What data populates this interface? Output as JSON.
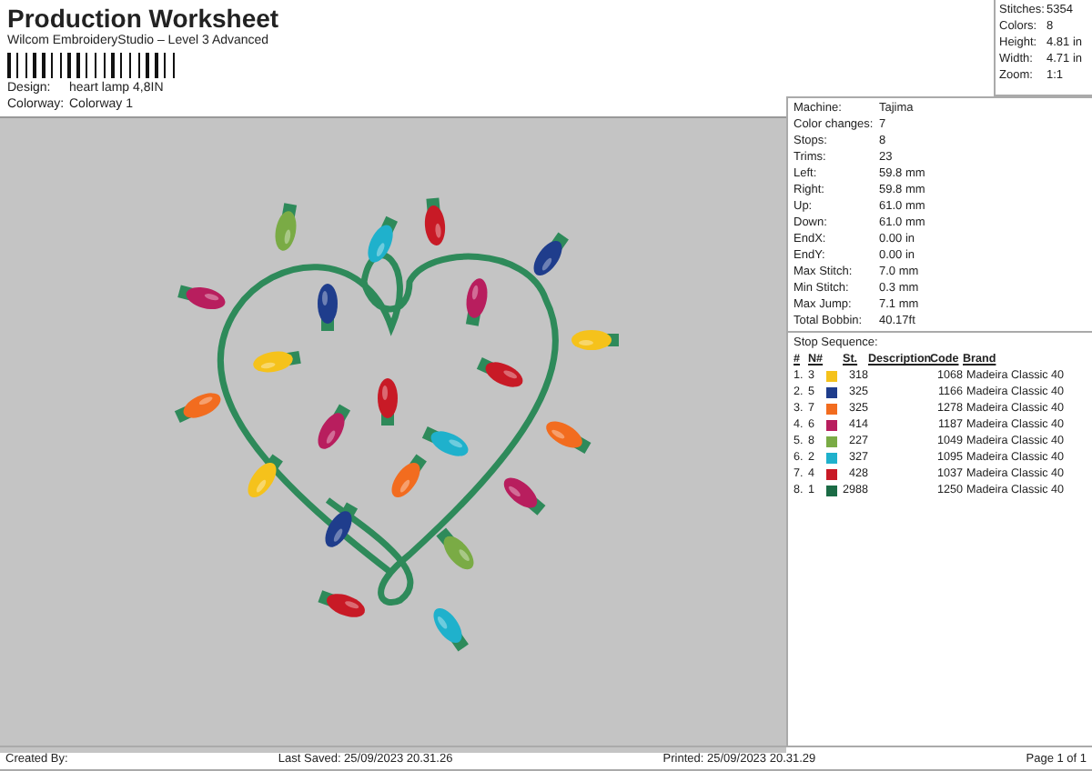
{
  "header": {
    "title": "Production Worksheet",
    "subtitle": "Wilcom EmbroideryStudio – Level 3 Advanced",
    "fields": [
      {
        "label": "Design:",
        "value": "heart lamp 4,8IN"
      },
      {
        "label": "Colorway:",
        "value": "Colorway 1"
      }
    ]
  },
  "summary": [
    {
      "label": "Stitches:",
      "value": "5354"
    },
    {
      "label": "Colors:",
      "value": "8"
    },
    {
      "label": "Height:",
      "value": "4.81 in"
    },
    {
      "label": "Width:",
      "value": "4.71 in"
    },
    {
      "label": "Zoom:",
      "value": "1:1"
    }
  ],
  "details": [
    {
      "label": "Machine:",
      "value": "Tajima"
    },
    {
      "label": "Color changes:",
      "value": "7"
    },
    {
      "label": "Stops:",
      "value": "8"
    },
    {
      "label": "Trims:",
      "value": "23"
    },
    {
      "label": "Left:",
      "value": "59.8 mm"
    },
    {
      "label": "Right:",
      "value": "59.8 mm"
    },
    {
      "label": "Up:",
      "value": "61.0 mm"
    },
    {
      "label": "Down:",
      "value": "61.0 mm"
    },
    {
      "label": "EndX:",
      "value": "0.00 in"
    },
    {
      "label": "EndY:",
      "value": "0.00 in"
    },
    {
      "label": "Max Stitch:",
      "value": "7.0 mm"
    },
    {
      "label": "Min Stitch:",
      "value": "0.3 mm"
    },
    {
      "label": "Max Jump:",
      "value": "7.1 mm"
    },
    {
      "label": "Total Bobbin:",
      "value": "40.17ft"
    }
  ],
  "stop_sequence": {
    "title": "Stop Sequence:",
    "columns": [
      "#",
      "N#",
      "St.",
      "Description",
      "Code",
      "Brand"
    ],
    "rows": [
      {
        "index": "1.",
        "needle": "3",
        "color": "#f5c21b",
        "stitches": "318",
        "code": "1068",
        "brand": "Madeira Classic 40"
      },
      {
        "index": "2.",
        "needle": "5",
        "color": "#1f3d8c",
        "stitches": "325",
        "code": "1166",
        "brand": "Madeira Classic 40"
      },
      {
        "index": "3.",
        "needle": "7",
        "color": "#f26c1f",
        "stitches": "325",
        "code": "1278",
        "brand": "Madeira Classic 40"
      },
      {
        "index": "4.",
        "needle": "6",
        "color": "#b81e5e",
        "stitches": "414",
        "code": "1187",
        "brand": "Madeira Classic 40"
      },
      {
        "index": "5.",
        "needle": "8",
        "color": "#7aab45",
        "stitches": "227",
        "code": "1049",
        "brand": "Madeira Classic 40"
      },
      {
        "index": "6.",
        "needle": "2",
        "color": "#1fb1cc",
        "stitches": "327",
        "code": "1095",
        "brand": "Madeira Classic 40"
      },
      {
        "index": "7.",
        "needle": "4",
        "color": "#c81a26",
        "stitches": "428",
        "code": "1037",
        "brand": "Madeira Classic 40"
      },
      {
        "index": "8.",
        "needle": "1",
        "color": "#1b6b45",
        "stitches": "2988",
        "code": "1250",
        "brand": "Madeira Classic 40"
      }
    ]
  },
  "footer": {
    "created_by": "Created By:",
    "last_saved": "Last Saved: 25/09/2023 20.31.26",
    "printed": "Printed: 25/09/2023 20.31.29",
    "page": "Page 1 of 1"
  }
}
